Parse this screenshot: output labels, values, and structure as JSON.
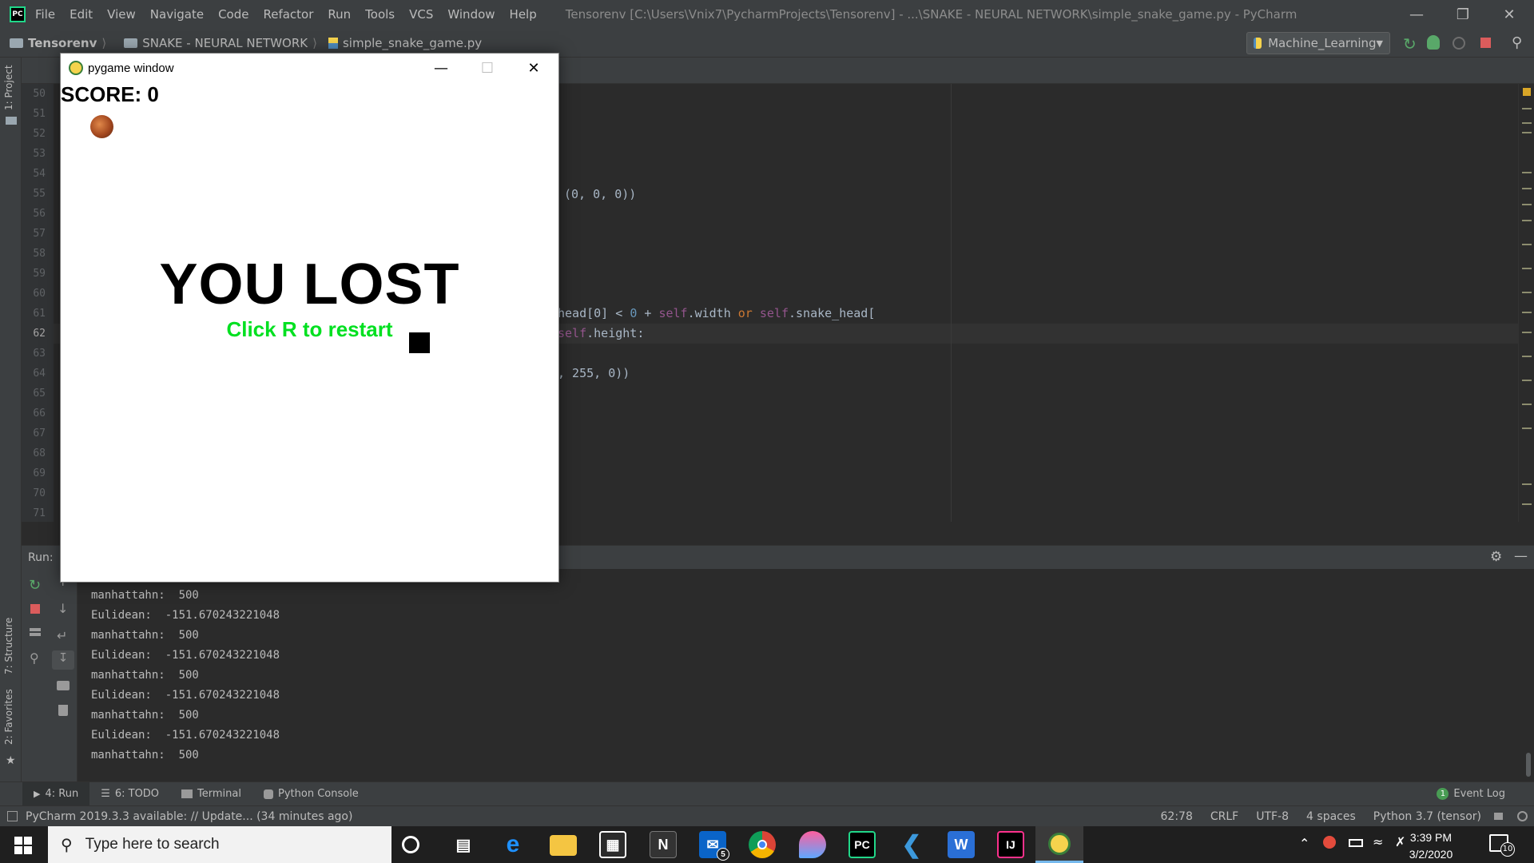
{
  "window": {
    "menu": [
      "File",
      "Edit",
      "View",
      "Navigate",
      "Code",
      "Refactor",
      "Run",
      "Tools",
      "VCS",
      "Window",
      "Help"
    ],
    "title": "Tensorenv [C:\\Users\\Vnix7\\PycharmProjects\\Tensorenv] - ...\\SNAKE - NEURAL NETWORK\\simple_snake_game.py - PyCharm"
  },
  "breadcrumb": [
    "Tensorenv",
    "SNAKE - NEURAL NETWORK",
    "simple_snake_game.py"
  ],
  "run_config": "Machine_Learning",
  "editor": {
    "line_numbers": [
      "50",
      "51",
      "52",
      "53",
      "54",
      "55",
      "56",
      "57",
      "58",
      "59",
      "60",
      "61",
      "62",
      "63",
      "64",
      "65",
      "66",
      "67",
      "68",
      "69",
      "70",
      "71"
    ],
    "code_line_55": "(0, 0, 0))",
    "code_line_61_a": "head[0] < ",
    "code_line_61_b": "0",
    "code_line_61_c": " + ",
    "code_line_61_d": "self",
    "code_line_61_e": ".width ",
    "code_line_61_f": "or ",
    "code_line_61_g": "self",
    "code_line_61_h": ".snake_head[",
    "code_line_62_a": "self",
    "code_line_62_b": ".height:",
    "code_line_64": ", 255, 0))"
  },
  "run_panel": {
    "label": "Run:",
    "console_lines": [
      "manhattahn:  500",
      "Eulidean:  -151.670243221048",
      "manhattahn:  500",
      "Eulidean:  -151.670243221048",
      "manhattahn:  500",
      "Eulidean:  -151.670243221048",
      "manhattahn:  500",
      "Eulidean:  -151.670243221048",
      "manhattahn:  500"
    ]
  },
  "side_labels": {
    "project": "1: Project",
    "structure": "7: Structure",
    "favorites": "2: Favorites"
  },
  "tool_tabs": {
    "run": "4: Run",
    "todo": "6: TODO",
    "terminal": "Terminal",
    "python_console": "Python Console",
    "event_log": "Event Log",
    "event_count": "1"
  },
  "status": {
    "message": "PyCharm 2019.3.3 available: // Update... (34 minutes ago)",
    "position": "62:78",
    "line_sep": "CRLF",
    "encoding": "UTF-8",
    "indent": "4 spaces",
    "interpreter": "Python 3.7 (tensor)"
  },
  "pygame": {
    "title": "pygame window",
    "score": "SCORE: 0",
    "lost": "YOU LOST",
    "restart": "Click R to restart",
    "restart_color": "#00e020"
  },
  "taskbar": {
    "search_placeholder": "Type here to search",
    "mail_badge": "5",
    "time": "3:39 PM",
    "date": "3/2/2020",
    "notif_count": "10"
  }
}
